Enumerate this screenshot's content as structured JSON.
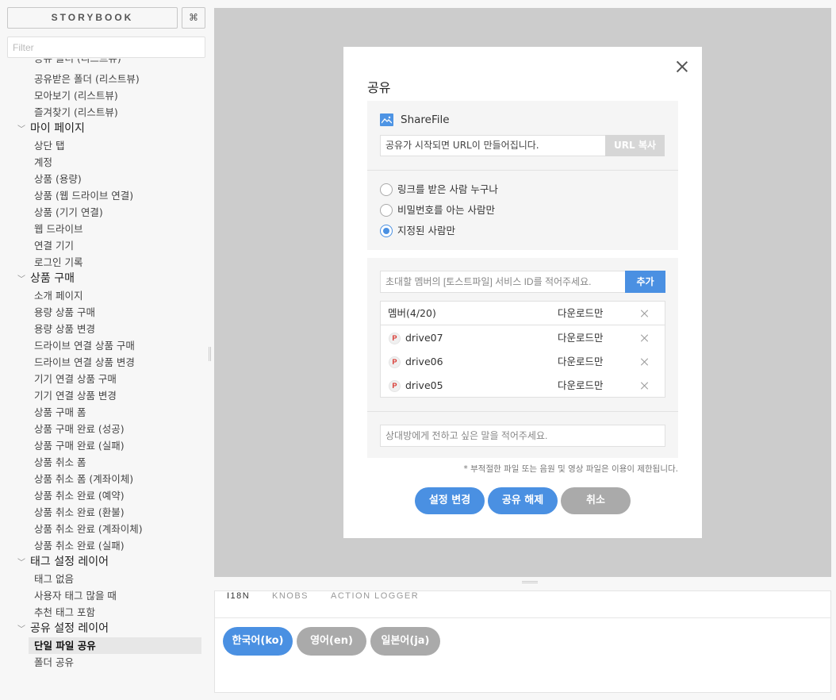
{
  "sidebar": {
    "brand": "STORYBOOK",
    "shortcut": "⌘",
    "filter_placeholder": "Filter",
    "clipped_item": "공유 폴더 (리스트뷰)",
    "items": [
      {
        "type": "leaf",
        "label": "공유받은 폴더 (리스트뷰)"
      },
      {
        "type": "leaf",
        "label": "모아보기 (리스트뷰)"
      },
      {
        "type": "leaf",
        "label": "즐겨찾기 (리스트뷰)"
      },
      {
        "type": "group",
        "label": "마이 페이지"
      },
      {
        "type": "leaf",
        "label": "상단 탭"
      },
      {
        "type": "leaf",
        "label": "계정"
      },
      {
        "type": "leaf",
        "label": "상품 (용량)"
      },
      {
        "type": "leaf",
        "label": "상품 (웹 드라이브 연결)"
      },
      {
        "type": "leaf",
        "label": "상품 (기기 연결)"
      },
      {
        "type": "leaf",
        "label": "웹 드라이브"
      },
      {
        "type": "leaf",
        "label": "연결 기기"
      },
      {
        "type": "leaf",
        "label": "로그인 기록"
      },
      {
        "type": "group",
        "label": "상품 구매"
      },
      {
        "type": "leaf",
        "label": "소개 페이지"
      },
      {
        "type": "leaf",
        "label": "용량 상품 구매"
      },
      {
        "type": "leaf",
        "label": "용량 상품 변경"
      },
      {
        "type": "leaf",
        "label": "드라이브 연결 상품 구매"
      },
      {
        "type": "leaf",
        "label": "드라이브 연결 상품 변경"
      },
      {
        "type": "leaf",
        "label": "기기 연결 상품 구매"
      },
      {
        "type": "leaf",
        "label": "기기 연결 상품 변경"
      },
      {
        "type": "leaf",
        "label": "상품 구매 폼"
      },
      {
        "type": "leaf",
        "label": "상품 구매 완료 (성공)"
      },
      {
        "type": "leaf",
        "label": "상품 구매 완료 (실패)"
      },
      {
        "type": "leaf",
        "label": "상품 취소 폼"
      },
      {
        "type": "leaf",
        "label": "상품 취소 폼 (계좌이체)"
      },
      {
        "type": "leaf",
        "label": "상품 취소 완료 (예약)"
      },
      {
        "type": "leaf",
        "label": "상품 취소 완료 (환불)"
      },
      {
        "type": "leaf",
        "label": "상품 취소 완료 (계좌이체)"
      },
      {
        "type": "leaf",
        "label": "상품 취소 완료 (실패)"
      },
      {
        "type": "group",
        "label": "태그 설정 레이어"
      },
      {
        "type": "leaf",
        "label": "태그 없음"
      },
      {
        "type": "leaf",
        "label": "사용자 태그 많을 때"
      },
      {
        "type": "leaf",
        "label": "추천 태그 포함"
      },
      {
        "type": "group",
        "label": "공유 설정 레이어"
      },
      {
        "type": "leaf",
        "label": "단일 파일 공유",
        "active": true
      },
      {
        "type": "leaf",
        "label": "폴더 공유"
      }
    ]
  },
  "modal": {
    "title": "공유",
    "file_name": "ShareFile",
    "url_text": "공유가 시작되면 URL이 만들어집니다.",
    "url_copy_label": "URL 복사",
    "radio_options": [
      {
        "label": "링크를 받은 사람 누구나",
        "checked": false
      },
      {
        "label": "비밀번호를 아는 사람만",
        "checked": false
      },
      {
        "label": "지정된 사람만",
        "checked": true
      }
    ],
    "invite_placeholder": "초대할 멤버의 [토스트파일] 서비스 ID를 적어주세요.",
    "add_label": "추가",
    "members_header": "멤버(4/20)",
    "members_header_perm": "다운로드만",
    "members": [
      {
        "badge": "P",
        "name": "drive07",
        "permission": "다운로드만"
      },
      {
        "badge": "P",
        "name": "drive06",
        "permission": "다운로드만"
      },
      {
        "badge": "P",
        "name": "drive05",
        "permission": "다운로드만"
      }
    ],
    "message_placeholder": "상대방에게 전하고 싶은 말을 적어주세요.",
    "notice": "* 부적절한 파일 또는 음원 및 영상 파일은 이용이 제한됩니다.",
    "buttons": {
      "apply": "설정 변경",
      "unshare": "공유 해제",
      "cancel": "취소"
    }
  },
  "addons": {
    "tabs": [
      {
        "label": "I18N",
        "active": true
      },
      {
        "label": "KNOBS",
        "active": false
      },
      {
        "label": "ACTION LOGGER",
        "active": false
      }
    ],
    "locales": [
      {
        "label": "한국어(ko)",
        "active": true
      },
      {
        "label": "영어(en)",
        "active": false
      },
      {
        "label": "일본어(ja)",
        "active": false
      }
    ]
  },
  "colors": {
    "accent": "#4a90e2",
    "canvas": "#cccccc",
    "muted_button": "#aaaaaa"
  }
}
